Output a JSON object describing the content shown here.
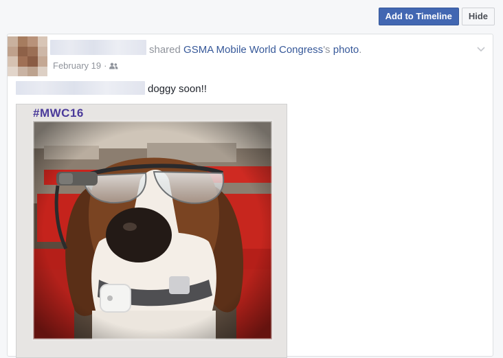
{
  "toolbar": {
    "add_label": "Add to Timeline",
    "hide_label": "Hide"
  },
  "story": {
    "headline_prefix": "shared",
    "page_name": "GSMA Mobile World Congress",
    "possessive": "'s",
    "object": "photo",
    "period": ".",
    "date": "February 19",
    "separator": "·",
    "privacy_icon": "friends-icon",
    "menu_icon": "chevron-down-icon",
    "text": "doggy soon!!"
  },
  "photo": {
    "hashtag": "#MWC16"
  },
  "colors": {
    "brand_blue": "#4267b2",
    "link": "#365899",
    "meta_grey": "#90949c"
  }
}
